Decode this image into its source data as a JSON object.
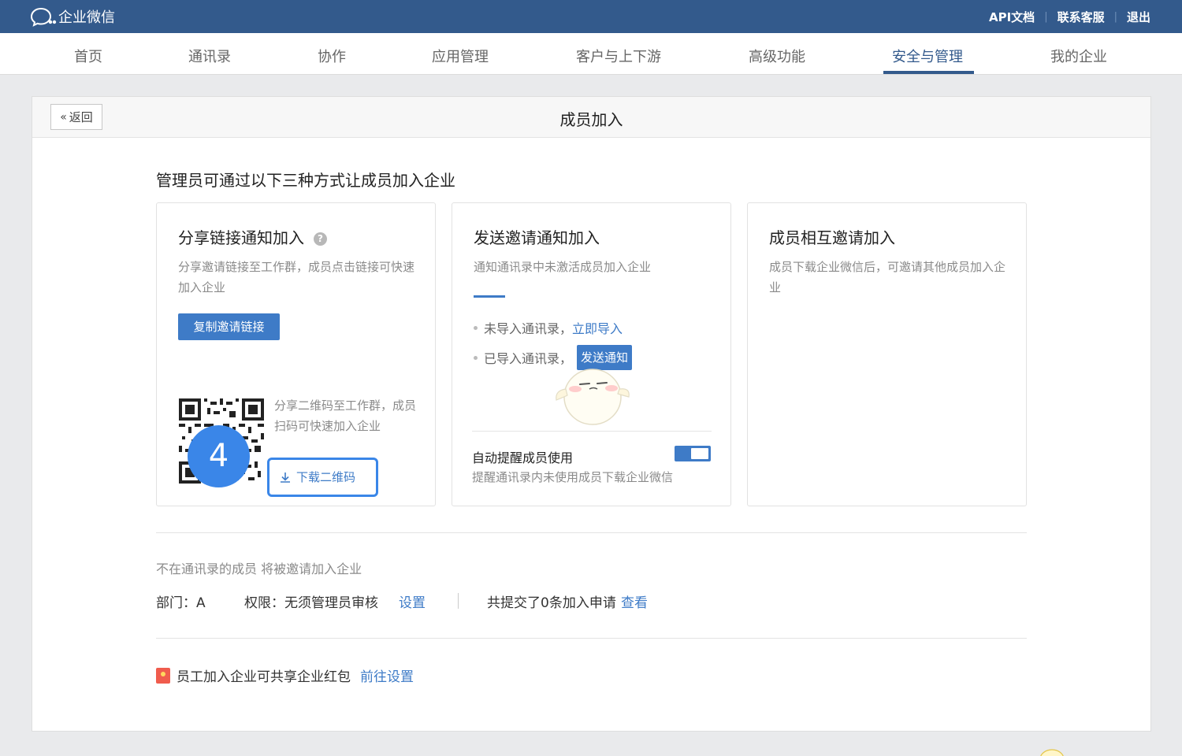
{
  "app": {
    "logo_text": "企业微信",
    "links": [
      "API文档",
      "联系客服",
      "退出"
    ]
  },
  "nav": {
    "items": [
      "首页",
      "通讯录",
      "协作",
      "应用管理",
      "客户与上下游",
      "高级功能",
      "安全与管理",
      "我的企业"
    ],
    "active_index": 6
  },
  "panel": {
    "back_label": "返回",
    "title": "成员加入",
    "intro": "管理员可通过以下三种方式让成员加入企业"
  },
  "card1": {
    "title": "分享链接通知加入",
    "desc": "分享邀请链接至工作群，成员点击链接可快速加入企业",
    "copy_button": "复制邀请链接",
    "qr_desc": "分享二维码至工作群，成员扫码可快速加入企业",
    "download_label": "下载二维码",
    "step_number": "4"
  },
  "card2": {
    "title": "发送邀请通知加入",
    "desc": "通知通讯录中未激活成员加入企业",
    "bullet1_text": "未导入通讯录，",
    "bullet1_link": "立即导入",
    "bullet2_text": "已导入通讯录，",
    "notify_button": "发送通知",
    "toggle_label": "自动提醒成员使用",
    "toggle_desc": "提醒通讯录内未使用成员下载企业微信",
    "toggle_on": true
  },
  "card3": {
    "title": "成员相互邀请加入",
    "desc": "成员下载企业微信后，可邀请其他成员加入企业"
  },
  "settings": {
    "note": "不在通讯录的成员 将被邀请加入企业",
    "dept_label": "部门：A",
    "perm_label": "权限：无须管理员审核",
    "perm_link": "设置",
    "apply_text": "共提交了0条加入申请",
    "apply_link": "查看"
  },
  "redpack": {
    "text": "员工加入企业可共享企业红包",
    "link": "前往设置"
  },
  "colors": {
    "brand": "#335a8c",
    "accent": "#3e7bc7",
    "highlight": "#3a86e8"
  }
}
